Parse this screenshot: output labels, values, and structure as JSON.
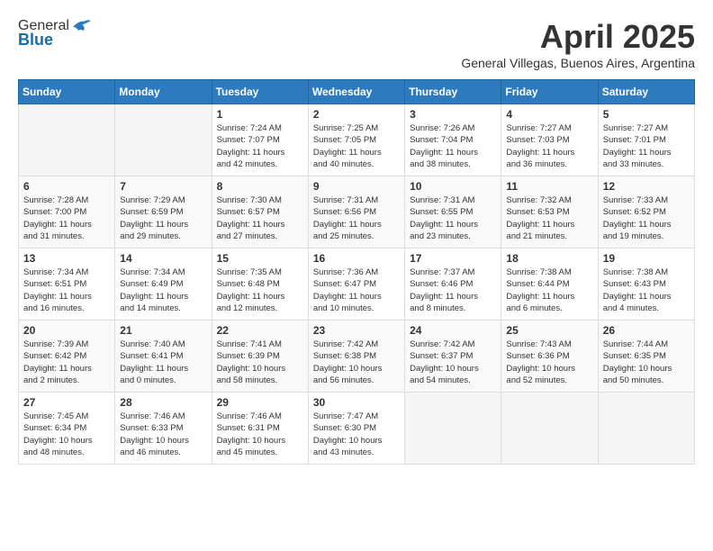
{
  "header": {
    "logo_general": "General",
    "logo_blue": "Blue",
    "month_title": "April 2025",
    "subtitle": "General Villegas, Buenos Aires, Argentina"
  },
  "weekdays": [
    "Sunday",
    "Monday",
    "Tuesday",
    "Wednesday",
    "Thursday",
    "Friday",
    "Saturday"
  ],
  "weeks": [
    [
      {
        "day": "",
        "info": ""
      },
      {
        "day": "",
        "info": ""
      },
      {
        "day": "1",
        "info": "Sunrise: 7:24 AM\nSunset: 7:07 PM\nDaylight: 11 hours\nand 42 minutes."
      },
      {
        "day": "2",
        "info": "Sunrise: 7:25 AM\nSunset: 7:05 PM\nDaylight: 11 hours\nand 40 minutes."
      },
      {
        "day": "3",
        "info": "Sunrise: 7:26 AM\nSunset: 7:04 PM\nDaylight: 11 hours\nand 38 minutes."
      },
      {
        "day": "4",
        "info": "Sunrise: 7:27 AM\nSunset: 7:03 PM\nDaylight: 11 hours\nand 36 minutes."
      },
      {
        "day": "5",
        "info": "Sunrise: 7:27 AM\nSunset: 7:01 PM\nDaylight: 11 hours\nand 33 minutes."
      }
    ],
    [
      {
        "day": "6",
        "info": "Sunrise: 7:28 AM\nSunset: 7:00 PM\nDaylight: 11 hours\nand 31 minutes."
      },
      {
        "day": "7",
        "info": "Sunrise: 7:29 AM\nSunset: 6:59 PM\nDaylight: 11 hours\nand 29 minutes."
      },
      {
        "day": "8",
        "info": "Sunrise: 7:30 AM\nSunset: 6:57 PM\nDaylight: 11 hours\nand 27 minutes."
      },
      {
        "day": "9",
        "info": "Sunrise: 7:31 AM\nSunset: 6:56 PM\nDaylight: 11 hours\nand 25 minutes."
      },
      {
        "day": "10",
        "info": "Sunrise: 7:31 AM\nSunset: 6:55 PM\nDaylight: 11 hours\nand 23 minutes."
      },
      {
        "day": "11",
        "info": "Sunrise: 7:32 AM\nSunset: 6:53 PM\nDaylight: 11 hours\nand 21 minutes."
      },
      {
        "day": "12",
        "info": "Sunrise: 7:33 AM\nSunset: 6:52 PM\nDaylight: 11 hours\nand 19 minutes."
      }
    ],
    [
      {
        "day": "13",
        "info": "Sunrise: 7:34 AM\nSunset: 6:51 PM\nDaylight: 11 hours\nand 16 minutes."
      },
      {
        "day": "14",
        "info": "Sunrise: 7:34 AM\nSunset: 6:49 PM\nDaylight: 11 hours\nand 14 minutes."
      },
      {
        "day": "15",
        "info": "Sunrise: 7:35 AM\nSunset: 6:48 PM\nDaylight: 11 hours\nand 12 minutes."
      },
      {
        "day": "16",
        "info": "Sunrise: 7:36 AM\nSunset: 6:47 PM\nDaylight: 11 hours\nand 10 minutes."
      },
      {
        "day": "17",
        "info": "Sunrise: 7:37 AM\nSunset: 6:46 PM\nDaylight: 11 hours\nand 8 minutes."
      },
      {
        "day": "18",
        "info": "Sunrise: 7:38 AM\nSunset: 6:44 PM\nDaylight: 11 hours\nand 6 minutes."
      },
      {
        "day": "19",
        "info": "Sunrise: 7:38 AM\nSunset: 6:43 PM\nDaylight: 11 hours\nand 4 minutes."
      }
    ],
    [
      {
        "day": "20",
        "info": "Sunrise: 7:39 AM\nSunset: 6:42 PM\nDaylight: 11 hours\nand 2 minutes."
      },
      {
        "day": "21",
        "info": "Sunrise: 7:40 AM\nSunset: 6:41 PM\nDaylight: 11 hours\nand 0 minutes."
      },
      {
        "day": "22",
        "info": "Sunrise: 7:41 AM\nSunset: 6:39 PM\nDaylight: 10 hours\nand 58 minutes."
      },
      {
        "day": "23",
        "info": "Sunrise: 7:42 AM\nSunset: 6:38 PM\nDaylight: 10 hours\nand 56 minutes."
      },
      {
        "day": "24",
        "info": "Sunrise: 7:42 AM\nSunset: 6:37 PM\nDaylight: 10 hours\nand 54 minutes."
      },
      {
        "day": "25",
        "info": "Sunrise: 7:43 AM\nSunset: 6:36 PM\nDaylight: 10 hours\nand 52 minutes."
      },
      {
        "day": "26",
        "info": "Sunrise: 7:44 AM\nSunset: 6:35 PM\nDaylight: 10 hours\nand 50 minutes."
      }
    ],
    [
      {
        "day": "27",
        "info": "Sunrise: 7:45 AM\nSunset: 6:34 PM\nDaylight: 10 hours\nand 48 minutes."
      },
      {
        "day": "28",
        "info": "Sunrise: 7:46 AM\nSunset: 6:33 PM\nDaylight: 10 hours\nand 46 minutes."
      },
      {
        "day": "29",
        "info": "Sunrise: 7:46 AM\nSunset: 6:31 PM\nDaylight: 10 hours\nand 45 minutes."
      },
      {
        "day": "30",
        "info": "Sunrise: 7:47 AM\nSunset: 6:30 PM\nDaylight: 10 hours\nand 43 minutes."
      },
      {
        "day": "",
        "info": ""
      },
      {
        "day": "",
        "info": ""
      },
      {
        "day": "",
        "info": ""
      }
    ]
  ]
}
